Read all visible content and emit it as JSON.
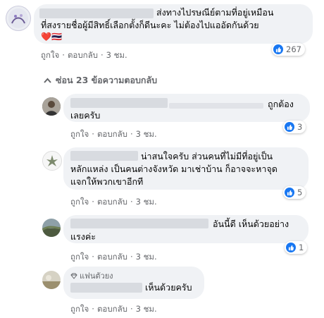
{
  "comments": [
    {
      "lines": [
        "ส่งทางไปรษณีย์ตามที่อยู่เหมือน",
        "ที่สงรายชื่อผู้มีสิทธิ์เลือกตั้งก็ดีนะคะ ไม่ต้องไปแออัดกันด้วย"
      ],
      "emoji_label": "❤️🇹🇭",
      "like_label": "ถูกใจ",
      "reply_label": "ตอบกลับ",
      "time": "3 ชม.",
      "reaction_count": "267"
    },
    {
      "lines": [
        "ถูกต้อง",
        "เลยครับ"
      ],
      "like_label": "ถูกใจ",
      "reply_label": "ตอบกลับ",
      "time": "3 ชม.",
      "reaction_count": "3"
    },
    {
      "lines": [
        "น่าสนใจครับ ส่วนคนที่ไม่มีที่อยู่เป็น",
        "หลักแหล่ง เป็นคนต่างจังหวัด มาเช่าบ้าน ก็อาจจะหาจุด",
        "แจกให้พวกเขาอีกที"
      ],
      "like_label": "ถูกใจ",
      "reply_label": "ตอบกลับ",
      "time": "3 ชม.",
      "reaction_count": "5"
    },
    {
      "lines": [
        "อันนี้ดี เห็นด้วยอย่าง",
        "แรงค่ะ"
      ],
      "like_label": "ถูกใจ",
      "reply_label": "ตอบกลับ",
      "time": "3 ชม.",
      "reaction_count": "1"
    },
    {
      "badge": "แฟนตัวยง",
      "lines": [
        "เห็นด้วยครับ"
      ],
      "like_label": "ถูกใจ",
      "reply_label": "ตอบกลับ",
      "time": "3 ชม."
    }
  ],
  "hide_replies_label": "ซ่อน 23 ข้อความตอบกลับ",
  "colors": {
    "bubble": "#f0f2f5",
    "like_blue": "#1877f2",
    "secondary_text": "#65676b"
  }
}
